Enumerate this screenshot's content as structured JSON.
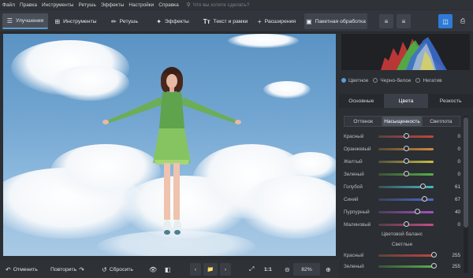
{
  "menu": {
    "items": [
      "Файл",
      "Правка",
      "Инструменты",
      "Ретушь",
      "Эффекты",
      "Настройки",
      "Справка"
    ],
    "search_placeholder": "Что вы хотите сделать?"
  },
  "toolbar": {
    "tabs": [
      "Улучшения",
      "Инструменты",
      "Ретушь",
      "Эффекты",
      "Текст и рамки",
      "Расширения"
    ],
    "batch_label": "Пакетная обработка",
    "active_tab": "Улучшения"
  },
  "bottom": {
    "undo": "Отменить",
    "redo": "Повторить",
    "reset": "Сбросить",
    "ratio": "1:1",
    "zoom": "82%"
  },
  "panel": {
    "color_modes": [
      "Цветное",
      "Черно-белое",
      "Негатив"
    ],
    "color_mode_selected": "Цветное",
    "tabs": [
      "Основные",
      "Цвета",
      "Резкость"
    ],
    "tab_selected": "Цвета",
    "subtabs": [
      "Оттенок",
      "Насыщенность",
      "Светлота"
    ],
    "subtab_selected": "Насыщенность",
    "sliders": [
      {
        "label": "Красный",
        "value": "0",
        "level": 0.5
      },
      {
        "label": "Оранжевый",
        "value": "0",
        "level": 0.5
      },
      {
        "label": "Желтый",
        "value": "0",
        "level": 0.5
      },
      {
        "label": "Зеленый",
        "value": "0",
        "level": 0.5
      },
      {
        "label": "Голубой",
        "value": "61",
        "level": 0.8
      },
      {
        "label": "Синий",
        "value": "67",
        "level": 0.83
      },
      {
        "label": "Пурпурный",
        "value": "40",
        "level": 0.7
      },
      {
        "label": "Малиновый",
        "value": "0",
        "level": 0.5
      }
    ],
    "balance_title": "Цветовой баланс",
    "balance_sub": "Светлые",
    "balance_sliders": [
      {
        "label": "Красный",
        "value": "255",
        "level": 1.0
      },
      {
        "label": "Зеленый",
        "value": "255",
        "level": 1.0
      }
    ]
  },
  "colors": {
    "accent": "#5b9bd5",
    "save_button": "#2f7ad6"
  }
}
